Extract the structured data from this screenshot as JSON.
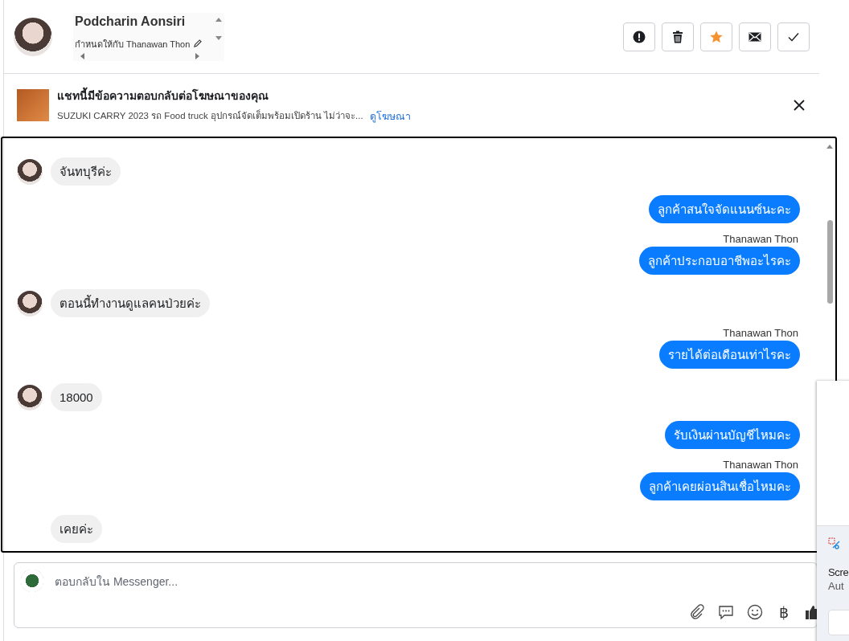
{
  "header": {
    "name": "Podcharin Aonsiri",
    "assigned": "กำหนดให้กับ Thanawan Thon",
    "actions": [
      {
        "kind": "spam"
      },
      {
        "kind": "delete"
      },
      {
        "kind": "star",
        "selected": true
      },
      {
        "kind": "unread"
      },
      {
        "kind": "done"
      }
    ]
  },
  "ad_banner": {
    "title": "แชทนี้มีข้อความตอบกลับต่อโฆษณาของคุณ",
    "description": "SUZUKI CARRY 2023 รถ Food truck อุปกรณ์จัดเต็มพร้อมเปิดร้าน ไม่ว่าจะ...",
    "link": "ดูโฆษณา"
  },
  "messages": [
    {
      "kind": "incoming",
      "avatar": true,
      "text": "จันทบุรีค่ะ"
    },
    {
      "kind": "outgoing",
      "text": "ลูกค้าสนใจจัดแนนซ์นะคะ"
    },
    {
      "kind": "outgoing",
      "sender": "Thanawan Thon",
      "text": "ลูกค้าประกอบอาชีพอะไรคะ"
    },
    {
      "kind": "incoming",
      "avatar": true,
      "text": "ตอนนี้ทำงานดูแลคนป่วยค่ะ"
    },
    {
      "kind": "outgoing",
      "sender": "Thanawan Thon",
      "text": "รายได้ต่อเดือนเท่าไรคะ"
    },
    {
      "kind": "incoming",
      "avatar": true,
      "text": "18000"
    },
    {
      "kind": "outgoing",
      "text": "รับเงินผ่านบัญชีไหมคะ"
    },
    {
      "kind": "outgoing",
      "sender": "Thanawan Thon",
      "text": "ลูกค้าเคยผ่อนสินเชื่อไหมคะ"
    },
    {
      "kind": "incoming",
      "avatar": false,
      "text": "เคยค่ะ"
    }
  ],
  "composer": {
    "placeholder": "ตอบกลับใน Messenger...",
    "currency_symbol": "฿"
  },
  "notification": {
    "title": "Scre",
    "subtitle": "Aut"
  }
}
